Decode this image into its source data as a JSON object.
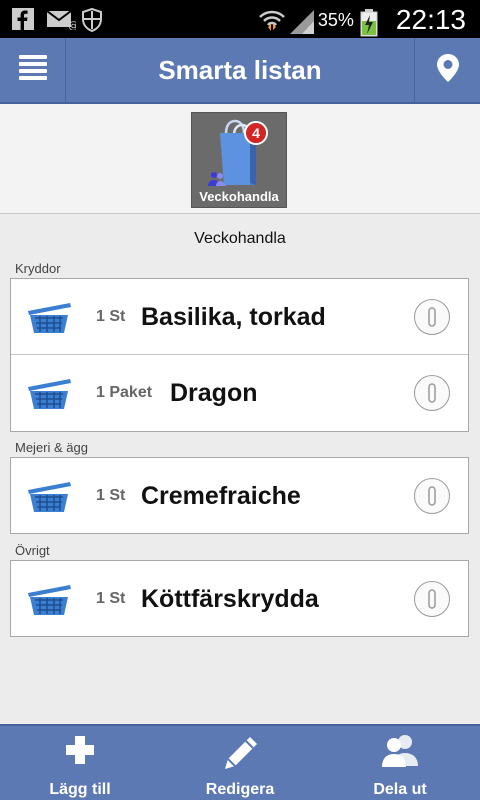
{
  "status_bar": {
    "battery_percent": "35%",
    "time": "22:13",
    "left_icons": [
      "facebook-icon",
      "mail-icon",
      "shield-icon"
    ],
    "right_icons": [
      "wifi-icon",
      "signal-icon",
      "battery-icon"
    ]
  },
  "header": {
    "title": "Smarta listan",
    "menu_icon": "menu-icon",
    "location_icon": "location-pin-icon"
  },
  "selector": {
    "list_tile": {
      "label": "Veckohandla",
      "badge": "4",
      "icon": "shopping-bag-icon",
      "shared_icon": "users-icon"
    }
  },
  "list_name": "Veckohandla",
  "categories": [
    {
      "name": "Kryddor",
      "items": [
        {
          "qty": "1 St",
          "name": "Basilika, torkad"
        },
        {
          "qty": "1 Paket",
          "name": "Dragon"
        }
      ]
    },
    {
      "name": "Mejeri & ägg",
      "items": [
        {
          "qty": "1 St",
          "name": "Cremefraiche"
        }
      ]
    },
    {
      "name": "Övrigt",
      "items": [
        {
          "qty": "1 St",
          "name": "Köttfärskrydda"
        }
      ]
    }
  ],
  "bottom_bar": {
    "add_label": "Lägg till",
    "edit_label": "Redigera",
    "share_label": "Dela ut"
  },
  "colors": {
    "header_blue": "#5d79b4",
    "badge_red": "#d42424",
    "basket_blue": "#3a7fd1"
  }
}
